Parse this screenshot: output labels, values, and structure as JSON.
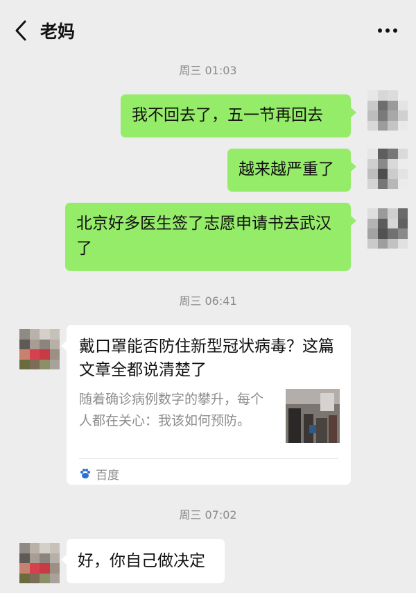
{
  "header": {
    "title": "老妈",
    "back_icon": "chevron-left-icon",
    "more_icon": "more-dots-icon"
  },
  "messages": {
    "time1": "周三 01:03",
    "out1": "我不回去了，五一节再回去",
    "out2": "越来越严重了",
    "out3": "北京好多医生签了志愿申请书去武汉了",
    "time2": "周三 06:41",
    "link": {
      "title": "戴口罩能否防住新型冠状病毒？这篇文章全都说清楚了",
      "description": "随着确诊病例数字的攀升，每个人都在关心：我该如何预防。",
      "source": "百度",
      "source_icon": "baidu-paw-icon"
    },
    "time3": "周三 07:02",
    "in1": "好，你自己做决定"
  },
  "colors": {
    "background": "#ededed",
    "outgoing_bubble": "#95ec69",
    "incoming_bubble": "#ffffff"
  }
}
